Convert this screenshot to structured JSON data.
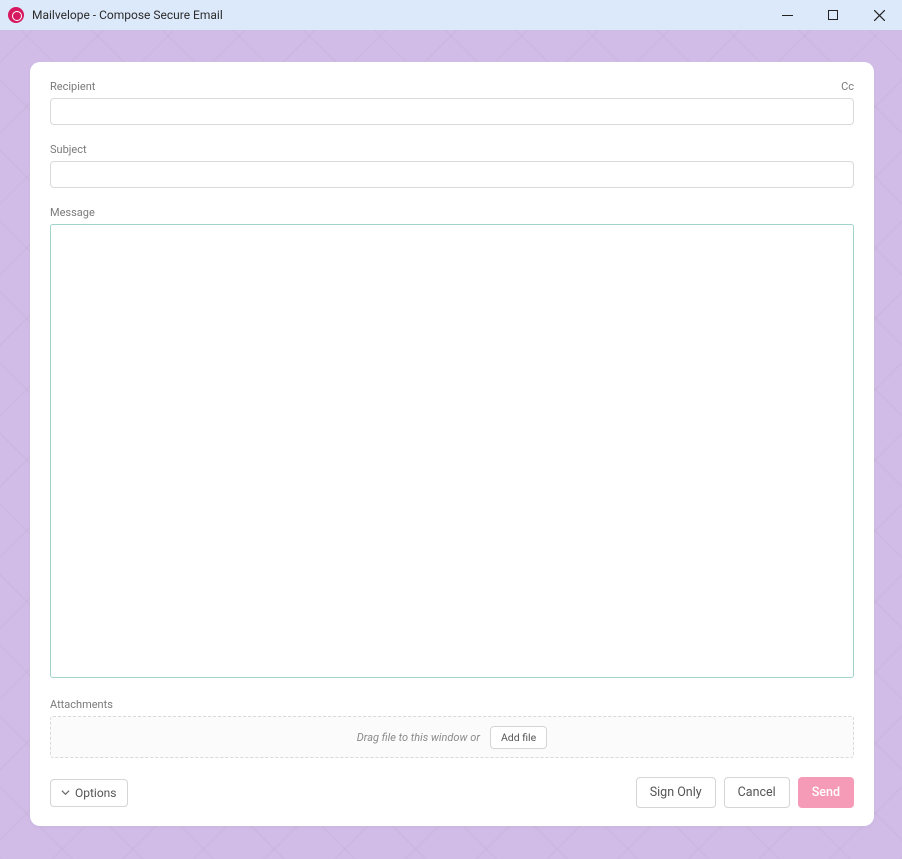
{
  "window": {
    "title": "Mailvelope - Compose Secure Email"
  },
  "labels": {
    "recipient": "Recipient",
    "cc": "Cc",
    "subject": "Subject",
    "message": "Message",
    "attachments": "Attachments"
  },
  "fields": {
    "recipient_value": "",
    "subject_value": "",
    "message_value": ""
  },
  "attachments": {
    "drop_text": "Drag file to this window or",
    "add_file_label": "Add file"
  },
  "footer": {
    "options_label": "Options",
    "sign_only_label": "Sign Only",
    "cancel_label": "Cancel",
    "send_label": "Send"
  }
}
